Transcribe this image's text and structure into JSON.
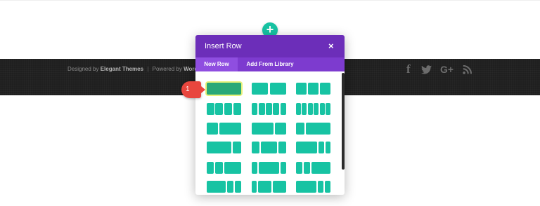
{
  "page": {
    "add_button_icon": "plus-icon"
  },
  "footer": {
    "credits_prefix": "Designed by",
    "credits_brand": "Elegant Themes",
    "credits_separator": "|",
    "credits_powered": "Powered by",
    "credits_wp": "WordPr",
    "social": [
      "facebook-icon",
      "twitter-icon",
      "google-plus-icon",
      "rss-icon"
    ]
  },
  "modal": {
    "title": "Insert Row",
    "close_glyph": "×",
    "tabs": [
      {
        "label": "New Row",
        "active": true
      },
      {
        "label": "Add From Library",
        "active": false
      }
    ],
    "selected_layout_index": 0
  },
  "badge": {
    "label": "1"
  },
  "colors": {
    "accent_teal": "#17c3a3",
    "modal_purple": "#6c2eb9",
    "tab_purple": "#7d3bcf",
    "badge_red": "#e8463e",
    "footer_bg": "#1f1f1f"
  }
}
